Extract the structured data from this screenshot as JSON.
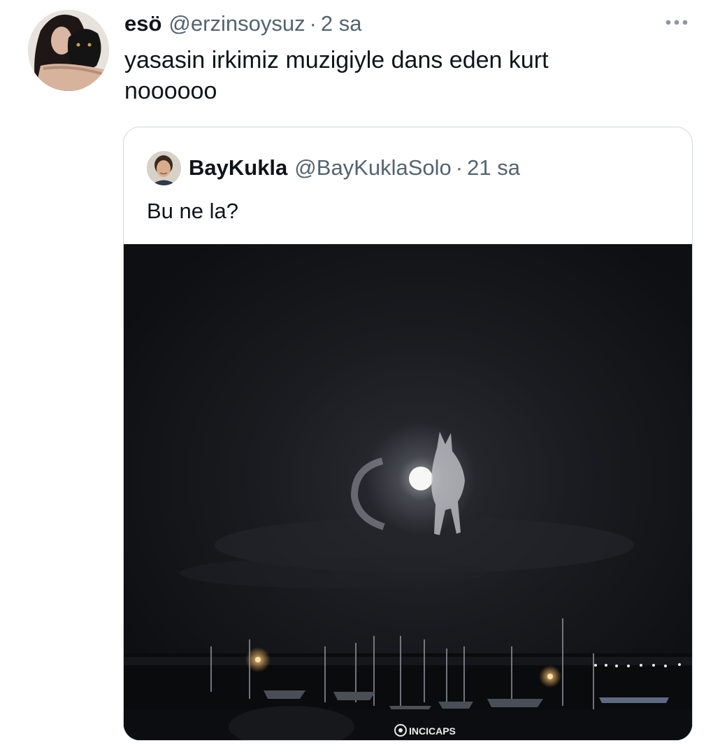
{
  "tweet": {
    "author_name": "esö",
    "author_handle": "@erzinsoysuz",
    "separator": "·",
    "time": "2 sa",
    "text_lines": [
      "yasasin irkimiz muzigiyle dans eden kurt",
      "noooooo"
    ]
  },
  "quoted": {
    "author_name": "BayKukla",
    "author_handle": "@BayKuklaSolo",
    "separator": "·",
    "time": "21 sa",
    "text": "Bu ne la?",
    "watermark": "INCICAPS"
  },
  "icons": {
    "more": "more-horizontal-icon"
  },
  "colors": {
    "text_primary": "#0f1419",
    "text_secondary": "#536471",
    "border": "#cfd9de",
    "night_sky": "#121316"
  }
}
